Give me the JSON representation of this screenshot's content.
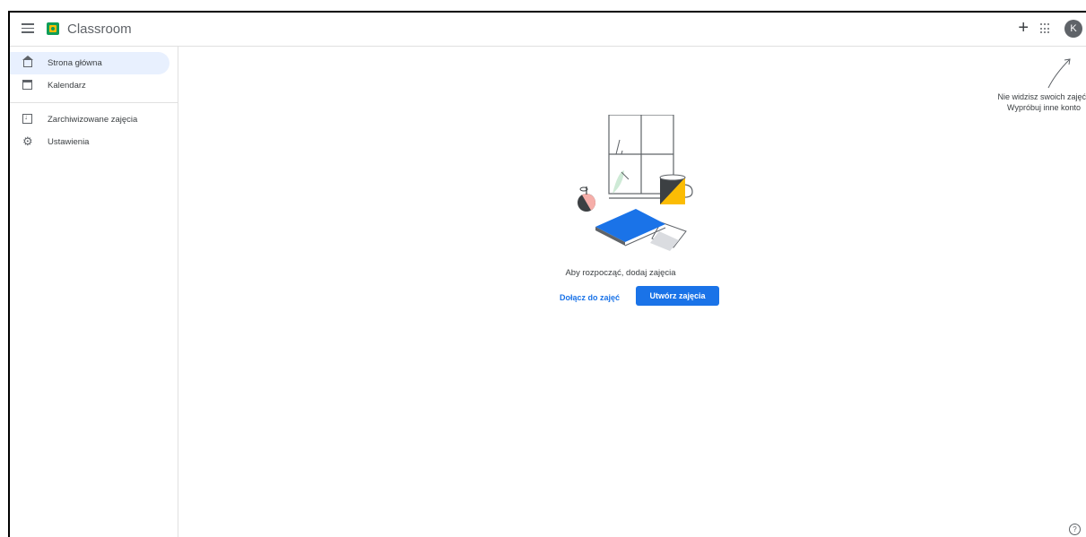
{
  "app": {
    "title": "Classroom",
    "avatar_letter": "K"
  },
  "header": {
    "add_icon": "plus-icon",
    "apps_icon": "apps-grid-icon"
  },
  "sidebar": {
    "items": [
      {
        "label": "Strona główna",
        "icon": "home-icon",
        "active": true
      },
      {
        "label": "Kalendarz",
        "icon": "calendar-icon",
        "active": false
      },
      {
        "label": "Zarchiwizowane zajęcia",
        "icon": "archive-icon",
        "active": false
      },
      {
        "label": "Ustawienia",
        "icon": "settings-icon",
        "active": false
      }
    ]
  },
  "main": {
    "empty_message": "Aby rozpocząć, dodaj zajęcia",
    "join_label": "Dołącz do zajęć",
    "create_label": "Utwórz zajęcia"
  },
  "hint": {
    "line1": "Nie widzisz swoich zajęć",
    "line2": "Wypróbuj inne konto"
  },
  "colors": {
    "accent": "#1a73e8",
    "active_bg": "#e8f0fe",
    "logo_green": "#0f9d58",
    "logo_yellow": "#fbbc04"
  }
}
